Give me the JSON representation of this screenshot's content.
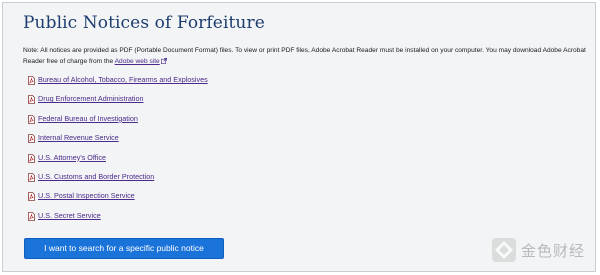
{
  "page": {
    "title": "Public Notices of Forfeiture",
    "note_text": "Note: All notices are provided as PDF (Portable Document Format) files. To view or print PDF files, Adobe Acrobat Reader must be installed on your computer. You may download Adobe Acrobat Reader free of charge from the ",
    "note_link": "Adobe web site"
  },
  "links": [
    {
      "label": "Bureau of Alcohol, Tobacco, Firearms and Explosives",
      "icon": "pdf-icon"
    },
    {
      "label": "Drug Enforcement Administration",
      "icon": "pdf-icon"
    },
    {
      "label": "Federal Bureau of Investigation",
      "icon": "pdf-icon"
    },
    {
      "label": "Internal Revenue Service",
      "icon": "pdf-icon"
    },
    {
      "label": "U.S. Attorney's Office",
      "icon": "pdf-icon"
    },
    {
      "label": "U.S. Customs and Border Protection",
      "icon": "pdf-icon"
    },
    {
      "label": "U.S. Postal Inspection Service",
      "icon": "pdf-icon"
    },
    {
      "label": "U.S. Secret Service",
      "icon": "pdf-icon"
    }
  ],
  "search_button": {
    "label": "I want to search for a specific public notice"
  },
  "watermark": {
    "text": "金色财经"
  },
  "colors": {
    "title": "#1d3d6e",
    "link": "#4a2a8a",
    "button": "#1a73d9",
    "background": "#f2f4f5"
  }
}
